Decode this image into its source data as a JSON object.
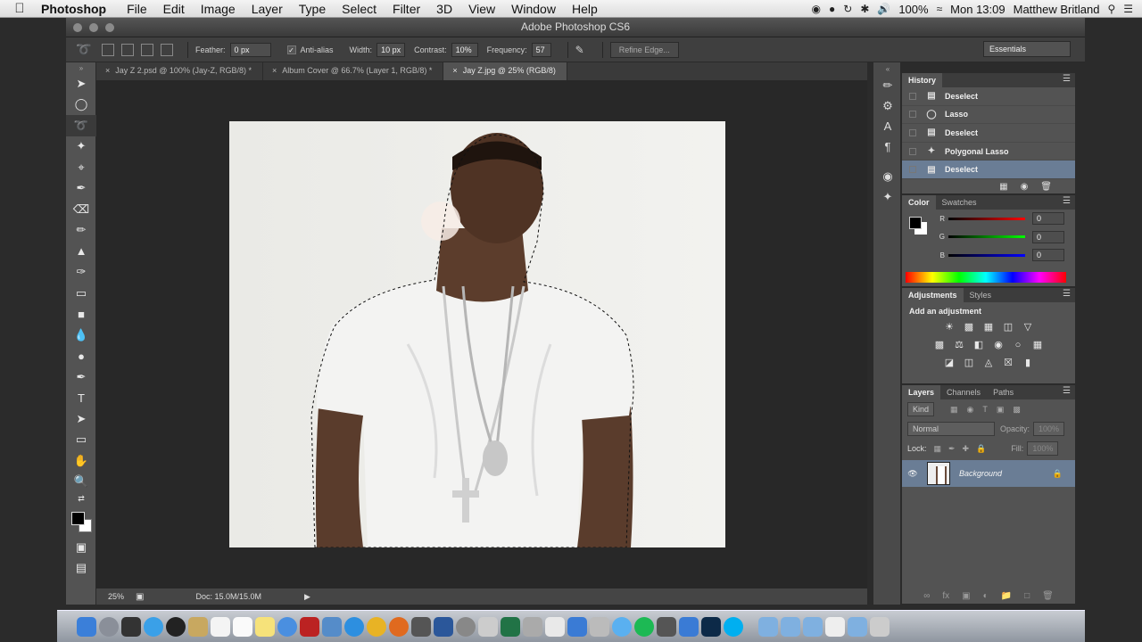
{
  "menubar": {
    "app": "Photoshop",
    "items": [
      "File",
      "Edit",
      "Image",
      "Layer",
      "Type",
      "Select",
      "Filter",
      "3D",
      "View",
      "Window",
      "Help"
    ],
    "battery": "100%",
    "clock": "Mon 13:09",
    "user": "Matthew Britland"
  },
  "window": {
    "title": "Adobe Photoshop CS6"
  },
  "options": {
    "feather_label": "Feather:",
    "feather_value": "0 px",
    "antialias_label": "Anti-alias",
    "width_label": "Width:",
    "width_value": "10 px",
    "contrast_label": "Contrast:",
    "contrast_value": "10%",
    "frequency_label": "Frequency:",
    "frequency_value": "57",
    "refine_edge": "Refine Edge...",
    "workspace": "Essentials"
  },
  "tabs": [
    {
      "label": "Jay Z 2.psd @ 100% (Jay-Z, RGB/8) *"
    },
    {
      "label": "Album Cover @ 66.7% (Layer 1, RGB/8) *"
    },
    {
      "label": "Jay Z.jpg @ 25% (RGB/8)"
    }
  ],
  "status": {
    "zoom": "25%",
    "doc": "Doc: 15.0M/15.0M"
  },
  "history": {
    "tab": "History",
    "rows": [
      {
        "label": "Deselect"
      },
      {
        "label": "Lasso"
      },
      {
        "label": "Deselect"
      },
      {
        "label": "Polygonal Lasso"
      },
      {
        "label": "Deselect"
      }
    ]
  },
  "color": {
    "tabs": [
      "Color",
      "Swatches"
    ],
    "r_label": "R",
    "g_label": "G",
    "b_label": "B",
    "r": "0",
    "g": "0",
    "b": "0"
  },
  "adjustments": {
    "tabs": [
      "Adjustments",
      "Styles"
    ],
    "subtitle": "Add an adjustment"
  },
  "layers": {
    "tabs": [
      "Layers",
      "Channels",
      "Paths"
    ],
    "kind": "Kind",
    "blend": "Normal",
    "opacity_label": "Opacity:",
    "opacity": "100%",
    "lock_label": "Lock:",
    "fill_label": "Fill:",
    "fill": "100%",
    "layer_name": "Background"
  },
  "colors": {
    "accent": "#6a7d95"
  }
}
